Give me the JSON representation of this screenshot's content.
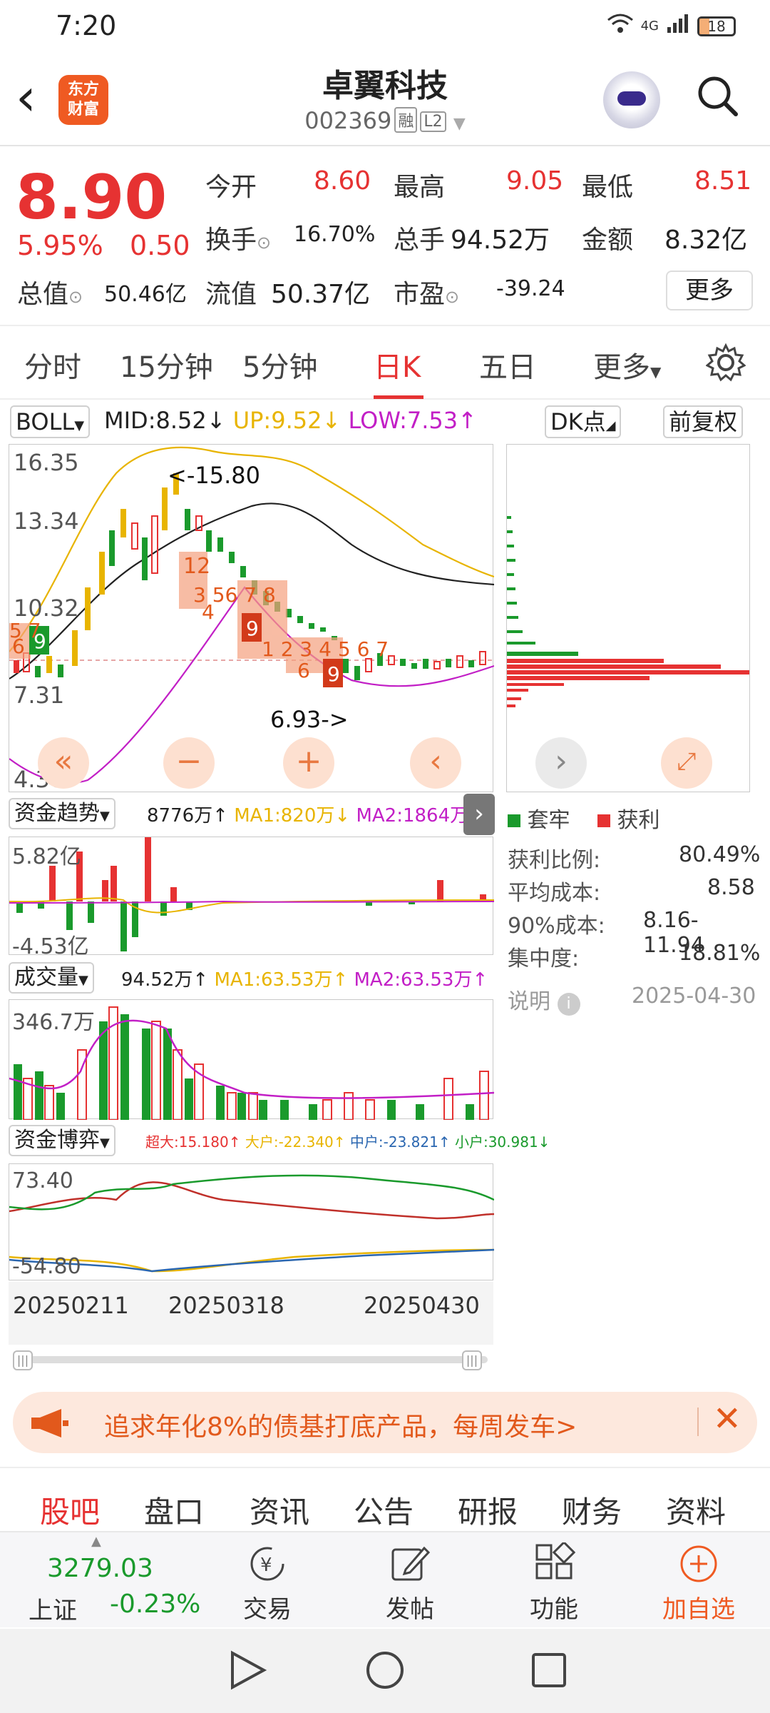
{
  "status": {
    "time": "7:20",
    "net": "4G",
    "battery": "18"
  },
  "header": {
    "logo_line1": "东方",
    "logo_line2": "财富",
    "name": "卓翼科技",
    "code": "002369",
    "tag1": "融",
    "tag2": "L2"
  },
  "quote": {
    "price": "8.90",
    "pct": "5.95%",
    "change": "0.50",
    "open_l": "今开",
    "open": "8.60",
    "high_l": "最高",
    "high": "9.05",
    "low_l": "最低",
    "low": "8.51",
    "turn_l": "换手",
    "turn": "16.70%",
    "vol_l": "总手",
    "vol": "94.52万",
    "amt_l": "金额",
    "amt": "8.32亿",
    "mcap_l": "总值",
    "mcap": "50.46亿",
    "float_l": "流值",
    "float": "50.37亿",
    "pe_l": "市盈",
    "pe": "-39.24",
    "more": "更多"
  },
  "tabs": [
    "分时",
    "15分钟",
    "5分钟",
    "日K",
    "五日",
    "更多"
  ],
  "boll": {
    "sel": "BOLL",
    "mid": "MID:8.52↓",
    "up": "UP:9.52↓",
    "low": "LOW:7.53↑",
    "dk": "DK点",
    "fq": "前复权"
  },
  "kchart": {
    "y1": "16.35",
    "y2": "13.34",
    "y3": "10.32",
    "y4": "7.31",
    "y5": "4.30",
    "hi": "<-15.80",
    "lo": "6.93->"
  },
  "fund": {
    "sel": "资金趋势",
    "v": "8776万↑",
    "ma1": "MA1:820万↓",
    "ma2": "MA2:1864万↑",
    "ytop": "5.82亿",
    "ybot": "-4.53亿"
  },
  "vol": {
    "sel": "成交量",
    "v": "94.52万↑",
    "ma1": "MA1:63.53万↑",
    "ma2": "MA2:63.53万↑",
    "ytop": "346.7万"
  },
  "game": {
    "sel": "资金博弈",
    "a": "超大:15.180↑",
    "b": "大户:-22.340↑",
    "c": "中户:-23.821↑",
    "d": "小户:30.981↓",
    "ytop": "73.40",
    "ybot": "-54.80"
  },
  "dates": [
    "20250211",
    "20250318",
    "20250430"
  ],
  "chip": {
    "leg1": "套牢",
    "leg2": "获利",
    "r1_l": "获利比例:",
    "r1": "80.49%",
    "r2_l": "平均成本:",
    "r2": "8.58",
    "r3_l": "90%成本:",
    "r3": "8.16-11.94",
    "r4_l": "集中度:",
    "r4": "18.81%",
    "note": "说明",
    "date": "2025-04-30"
  },
  "banner": {
    "text": "追求年化8%的债基打底产品，每周发车>"
  },
  "subtabs": [
    "股吧",
    "盘口",
    "资讯",
    "公告",
    "研报",
    "财务",
    "资料"
  ],
  "bottom": {
    "idx_val": "3279.03",
    "idx_name": "上证",
    "idx_chg": "-0.23%",
    "trade": "交易",
    "post": "发帖",
    "func": "功能",
    "add": "加自选"
  },
  "colors": {
    "up": "#e63232",
    "down": "#1a9a2c",
    "accent": "#ef5a22",
    "boll_up": "#e8b400",
    "boll_low": "#c21fc6"
  }
}
